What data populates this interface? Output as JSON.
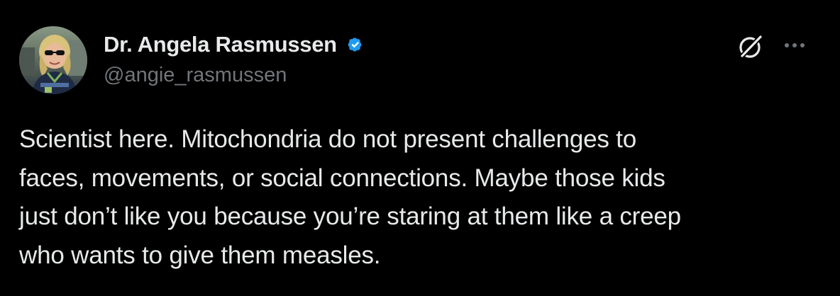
{
  "author": {
    "display_name": "Dr. Angela Rasmussen",
    "handle": "@angie_rasmussen",
    "verified": true,
    "avatar_icon": "profile-photo"
  },
  "actions": {
    "grok_icon": "grok-icon",
    "more_icon": "more-options-icon"
  },
  "tweet": {
    "text": "Scientist here. Mitochondria do not present challenges to\nfaces, movements, or social connections. Maybe those kids\njust don’t like you because you’re staring at them like a creep\nwho wants to give them measles."
  },
  "colors": {
    "background": "#000000",
    "text_primary": "#e7e9ea",
    "text_secondary": "#71767b",
    "verified_badge": "#1d9bf0"
  }
}
